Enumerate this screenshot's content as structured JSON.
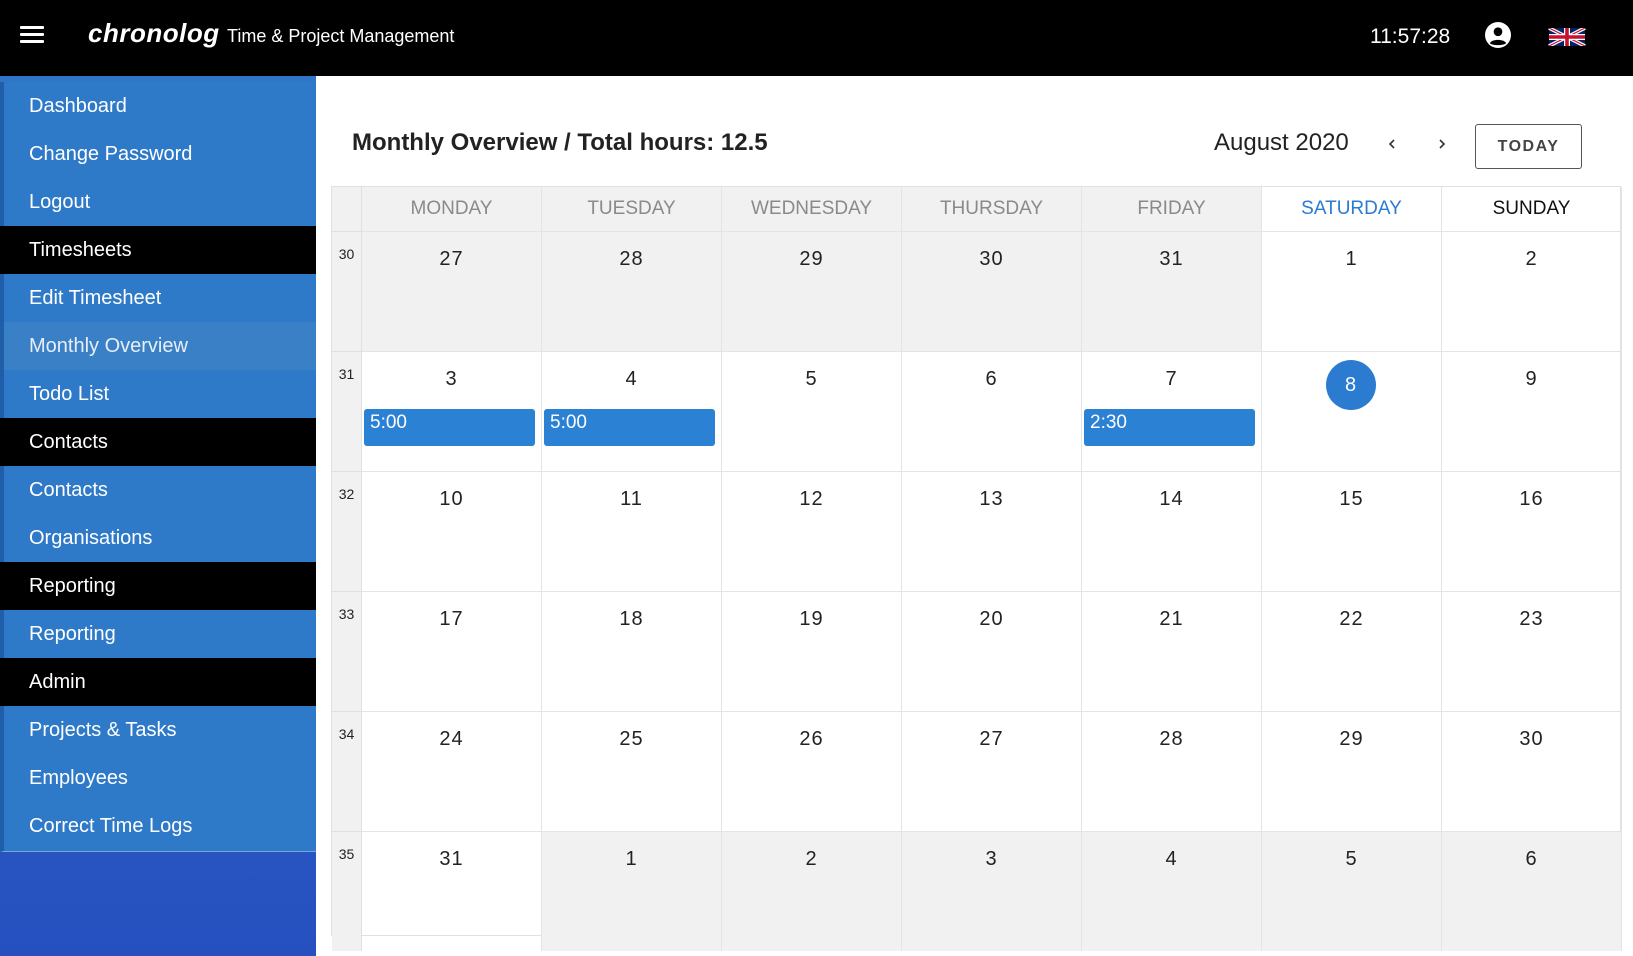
{
  "header": {
    "brand": "chronolog",
    "subtitle": "Time & Project Management",
    "clock": "11:57:28"
  },
  "sidebar": {
    "items": [
      {
        "label": "Dashboard",
        "kind": "link"
      },
      {
        "label": "Change Password",
        "kind": "link"
      },
      {
        "label": "Logout",
        "kind": "link"
      },
      {
        "label": "Timesheets",
        "kind": "header"
      },
      {
        "label": "Edit Timesheet",
        "kind": "link"
      },
      {
        "label": "Monthly Overview",
        "kind": "link",
        "active": true
      },
      {
        "label": "Todo List",
        "kind": "link"
      },
      {
        "label": "Contacts",
        "kind": "header"
      },
      {
        "label": "Contacts",
        "kind": "link"
      },
      {
        "label": "Organisations",
        "kind": "link"
      },
      {
        "label": "Reporting",
        "kind": "header"
      },
      {
        "label": "Reporting",
        "kind": "link"
      },
      {
        "label": "Admin",
        "kind": "header"
      },
      {
        "label": "Projects & Tasks",
        "kind": "link"
      },
      {
        "label": "Employees",
        "kind": "link"
      },
      {
        "label": "Correct Time Logs",
        "kind": "link"
      }
    ]
  },
  "main": {
    "title": "Monthly Overview / Total hours: 12.5",
    "month": "August 2020",
    "today_label": "TODAY"
  },
  "calendar": {
    "days": [
      "MONDAY",
      "TUESDAY",
      "WEDNESDAY",
      "THURSDAY",
      "FRIDAY",
      "SATURDAY",
      "SUNDAY"
    ],
    "weeks": [
      {
        "num": "30",
        "days": [
          {
            "d": "27",
            "grey": true
          },
          {
            "d": "28",
            "grey": true
          },
          {
            "d": "29",
            "grey": true
          },
          {
            "d": "30",
            "grey": true
          },
          {
            "d": "31",
            "grey": true
          },
          {
            "d": "1"
          },
          {
            "d": "2"
          }
        ]
      },
      {
        "num": "31",
        "days": [
          {
            "d": "3",
            "event": "5:00"
          },
          {
            "d": "4",
            "event": "5:00"
          },
          {
            "d": "5"
          },
          {
            "d": "6"
          },
          {
            "d": "7",
            "event": "2:30"
          },
          {
            "d": "8",
            "today": true
          },
          {
            "d": "9"
          }
        ]
      },
      {
        "num": "32",
        "days": [
          {
            "d": "10"
          },
          {
            "d": "11"
          },
          {
            "d": "12"
          },
          {
            "d": "13"
          },
          {
            "d": "14"
          },
          {
            "d": "15"
          },
          {
            "d": "16"
          }
        ]
      },
      {
        "num": "33",
        "days": [
          {
            "d": "17"
          },
          {
            "d": "18"
          },
          {
            "d": "19"
          },
          {
            "d": "20"
          },
          {
            "d": "21"
          },
          {
            "d": "22"
          },
          {
            "d": "23"
          }
        ]
      },
      {
        "num": "34",
        "days": [
          {
            "d": "24"
          },
          {
            "d": "25"
          },
          {
            "d": "26"
          },
          {
            "d": "27"
          },
          {
            "d": "28"
          },
          {
            "d": "29"
          },
          {
            "d": "30"
          }
        ]
      },
      {
        "num": "35",
        "days": [
          {
            "d": "31"
          },
          {
            "d": "1",
            "grey": true
          },
          {
            "d": "2",
            "grey": true
          },
          {
            "d": "3",
            "grey": true
          },
          {
            "d": "4",
            "grey": true
          },
          {
            "d": "5",
            "grey": true
          },
          {
            "d": "6",
            "grey": true
          }
        ]
      }
    ]
  },
  "colors": {
    "accent": "#2b7bd1",
    "event": "#2b82d4",
    "sidebar": "#2f7ac8",
    "topbar": "#000000"
  },
  "icons": {
    "menu": "hamburger-menu-icon",
    "account": "account-circle-icon",
    "language": "uk-flag-icon",
    "prev": "chevron-left-icon",
    "next": "chevron-right-icon"
  }
}
